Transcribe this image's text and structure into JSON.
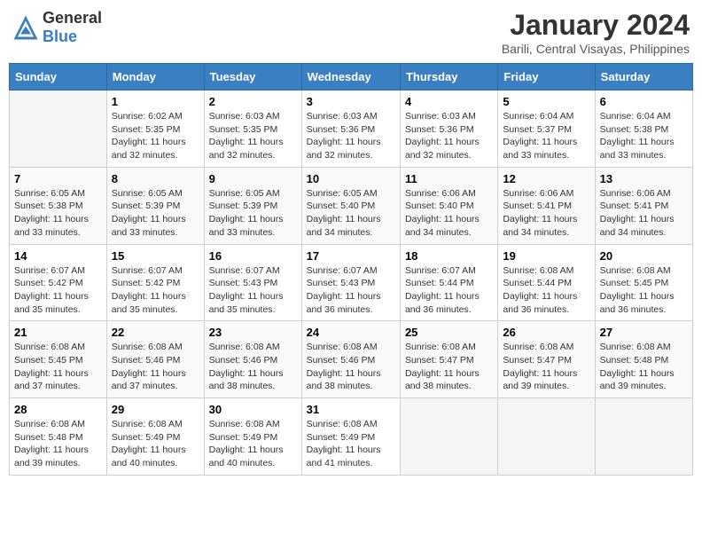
{
  "header": {
    "logo_general": "General",
    "logo_blue": "Blue",
    "title": "January 2024",
    "subtitle": "Barili, Central Visayas, Philippines"
  },
  "days_of_week": [
    "Sunday",
    "Monday",
    "Tuesday",
    "Wednesday",
    "Thursday",
    "Friday",
    "Saturday"
  ],
  "weeks": [
    [
      {
        "num": "",
        "sunrise": "",
        "sunset": "",
        "daylight": "",
        "empty": true
      },
      {
        "num": "1",
        "sunrise": "Sunrise: 6:02 AM",
        "sunset": "Sunset: 5:35 PM",
        "daylight": "Daylight: 11 hours and 32 minutes."
      },
      {
        "num": "2",
        "sunrise": "Sunrise: 6:03 AM",
        "sunset": "Sunset: 5:35 PM",
        "daylight": "Daylight: 11 hours and 32 minutes."
      },
      {
        "num": "3",
        "sunrise": "Sunrise: 6:03 AM",
        "sunset": "Sunset: 5:36 PM",
        "daylight": "Daylight: 11 hours and 32 minutes."
      },
      {
        "num": "4",
        "sunrise": "Sunrise: 6:03 AM",
        "sunset": "Sunset: 5:36 PM",
        "daylight": "Daylight: 11 hours and 32 minutes."
      },
      {
        "num": "5",
        "sunrise": "Sunrise: 6:04 AM",
        "sunset": "Sunset: 5:37 PM",
        "daylight": "Daylight: 11 hours and 33 minutes."
      },
      {
        "num": "6",
        "sunrise": "Sunrise: 6:04 AM",
        "sunset": "Sunset: 5:38 PM",
        "daylight": "Daylight: 11 hours and 33 minutes."
      }
    ],
    [
      {
        "num": "7",
        "sunrise": "Sunrise: 6:05 AM",
        "sunset": "Sunset: 5:38 PM",
        "daylight": "Daylight: 11 hours and 33 minutes."
      },
      {
        "num": "8",
        "sunrise": "Sunrise: 6:05 AM",
        "sunset": "Sunset: 5:39 PM",
        "daylight": "Daylight: 11 hours and 33 minutes."
      },
      {
        "num": "9",
        "sunrise": "Sunrise: 6:05 AM",
        "sunset": "Sunset: 5:39 PM",
        "daylight": "Daylight: 11 hours and 33 minutes."
      },
      {
        "num": "10",
        "sunrise": "Sunrise: 6:05 AM",
        "sunset": "Sunset: 5:40 PM",
        "daylight": "Daylight: 11 hours and 34 minutes."
      },
      {
        "num": "11",
        "sunrise": "Sunrise: 6:06 AM",
        "sunset": "Sunset: 5:40 PM",
        "daylight": "Daylight: 11 hours and 34 minutes."
      },
      {
        "num": "12",
        "sunrise": "Sunrise: 6:06 AM",
        "sunset": "Sunset: 5:41 PM",
        "daylight": "Daylight: 11 hours and 34 minutes."
      },
      {
        "num": "13",
        "sunrise": "Sunrise: 6:06 AM",
        "sunset": "Sunset: 5:41 PM",
        "daylight": "Daylight: 11 hours and 34 minutes."
      }
    ],
    [
      {
        "num": "14",
        "sunrise": "Sunrise: 6:07 AM",
        "sunset": "Sunset: 5:42 PM",
        "daylight": "Daylight: 11 hours and 35 minutes."
      },
      {
        "num": "15",
        "sunrise": "Sunrise: 6:07 AM",
        "sunset": "Sunset: 5:42 PM",
        "daylight": "Daylight: 11 hours and 35 minutes."
      },
      {
        "num": "16",
        "sunrise": "Sunrise: 6:07 AM",
        "sunset": "Sunset: 5:43 PM",
        "daylight": "Daylight: 11 hours and 35 minutes."
      },
      {
        "num": "17",
        "sunrise": "Sunrise: 6:07 AM",
        "sunset": "Sunset: 5:43 PM",
        "daylight": "Daylight: 11 hours and 36 minutes."
      },
      {
        "num": "18",
        "sunrise": "Sunrise: 6:07 AM",
        "sunset": "Sunset: 5:44 PM",
        "daylight": "Daylight: 11 hours and 36 minutes."
      },
      {
        "num": "19",
        "sunrise": "Sunrise: 6:08 AM",
        "sunset": "Sunset: 5:44 PM",
        "daylight": "Daylight: 11 hours and 36 minutes."
      },
      {
        "num": "20",
        "sunrise": "Sunrise: 6:08 AM",
        "sunset": "Sunset: 5:45 PM",
        "daylight": "Daylight: 11 hours and 36 minutes."
      }
    ],
    [
      {
        "num": "21",
        "sunrise": "Sunrise: 6:08 AM",
        "sunset": "Sunset: 5:45 PM",
        "daylight": "Daylight: 11 hours and 37 minutes."
      },
      {
        "num": "22",
        "sunrise": "Sunrise: 6:08 AM",
        "sunset": "Sunset: 5:46 PM",
        "daylight": "Daylight: 11 hours and 37 minutes."
      },
      {
        "num": "23",
        "sunrise": "Sunrise: 6:08 AM",
        "sunset": "Sunset: 5:46 PM",
        "daylight": "Daylight: 11 hours and 38 minutes."
      },
      {
        "num": "24",
        "sunrise": "Sunrise: 6:08 AM",
        "sunset": "Sunset: 5:46 PM",
        "daylight": "Daylight: 11 hours and 38 minutes."
      },
      {
        "num": "25",
        "sunrise": "Sunrise: 6:08 AM",
        "sunset": "Sunset: 5:47 PM",
        "daylight": "Daylight: 11 hours and 38 minutes."
      },
      {
        "num": "26",
        "sunrise": "Sunrise: 6:08 AM",
        "sunset": "Sunset: 5:47 PM",
        "daylight": "Daylight: 11 hours and 39 minutes."
      },
      {
        "num": "27",
        "sunrise": "Sunrise: 6:08 AM",
        "sunset": "Sunset: 5:48 PM",
        "daylight": "Daylight: 11 hours and 39 minutes."
      }
    ],
    [
      {
        "num": "28",
        "sunrise": "Sunrise: 6:08 AM",
        "sunset": "Sunset: 5:48 PM",
        "daylight": "Daylight: 11 hours and 39 minutes."
      },
      {
        "num": "29",
        "sunrise": "Sunrise: 6:08 AM",
        "sunset": "Sunset: 5:49 PM",
        "daylight": "Daylight: 11 hours and 40 minutes."
      },
      {
        "num": "30",
        "sunrise": "Sunrise: 6:08 AM",
        "sunset": "Sunset: 5:49 PM",
        "daylight": "Daylight: 11 hours and 40 minutes."
      },
      {
        "num": "31",
        "sunrise": "Sunrise: 6:08 AM",
        "sunset": "Sunset: 5:49 PM",
        "daylight": "Daylight: 11 hours and 41 minutes."
      },
      {
        "num": "",
        "sunrise": "",
        "sunset": "",
        "daylight": "",
        "empty": true
      },
      {
        "num": "",
        "sunrise": "",
        "sunset": "",
        "daylight": "",
        "empty": true
      },
      {
        "num": "",
        "sunrise": "",
        "sunset": "",
        "daylight": "",
        "empty": true
      }
    ]
  ]
}
